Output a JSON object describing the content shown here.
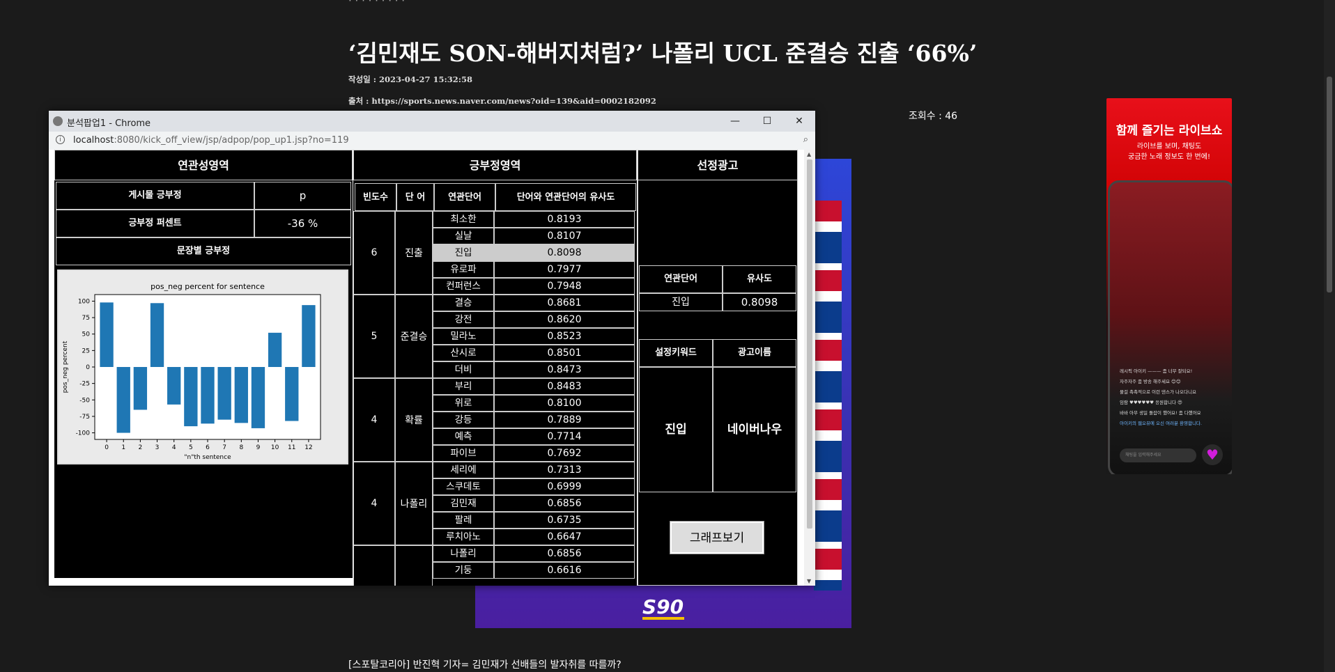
{
  "article": {
    "top_partial_text": "· · · · · · · · ·",
    "title": "‘김민재도 SON-해버지처럼?’ 나폴리 UCL 준결승 진출 ‘66%’",
    "date_line": "작성일 : 2023-04-27 15:32:58",
    "source_line": "출처 : https://sports.news.naver.com/news?oid=139&aid=0002182092",
    "views": "조회수 : 46",
    "body_first_line": "[스포탈코리아] 반진혁 기자= 김민재가 선배들의 발자취를 따를까?"
  },
  "background_ad": {
    "text": "S90"
  },
  "side_ad": {
    "headline": "함께 즐기는 라이브쇼",
    "subline1": "라이브를 보며, 채팅도",
    "subline2": "궁금한 노래 정보도 한 번에!",
    "chat_lines": [
      "레시픽 아이키 ——— 좀 너무 잘되요!",
      "자주자주 좀 방송 해주세요 😊😊",
      "물걸 촉촉적으로 이런 댄스가 나오다니요",
      "임람 ♥♥♥♥♥♥ 응원합니다 😍",
      "바바 아무 생일 돌잡이 했어요! 좀 다했어요",
      "아이키의 웹오뷰에 오신 여러분 환영합니다."
    ],
    "input_placeholder": "채팅을 입력해주세요",
    "icon": "heart-icon"
  },
  "popup": {
    "window_title": "분석팝업1 - Chrome",
    "url_host": "localhost",
    "url_path": ":8080/kick_off_view/jsp/adpop/pop_up1.jsp?no=119",
    "controls": {
      "minimize": "—",
      "maximize": "☐",
      "close": "✕"
    },
    "relevance": {
      "header": "연관성영역",
      "post_label": "게시물 긍부정",
      "post_value": "p",
      "percent_label": "긍부정 퍼센트",
      "percent_value": "-36 %",
      "sentence_label": "문장별 긍부정"
    },
    "posneg": {
      "header": "긍부정영역",
      "columns": [
        "빈도수",
        "단 어",
        "연관단어",
        "단어와 연관단어의 유사도"
      ],
      "groups": [
        {
          "freq": "6",
          "word": "진출",
          "rows": [
            {
              "word": "최소한",
              "sim": "0.8193"
            },
            {
              "word": "실날",
              "sim": "0.8107"
            },
            {
              "word": "진입",
              "sim": "0.8098",
              "highlight": true
            },
            {
              "word": "유로파",
              "sim": "0.7977"
            },
            {
              "word": "컨퍼런스",
              "sim": "0.7948"
            }
          ]
        },
        {
          "freq": "5",
          "word": "준결승",
          "rows": [
            {
              "word": "결승",
              "sim": "0.8681"
            },
            {
              "word": "강전",
              "sim": "0.8620"
            },
            {
              "word": "밀라노",
              "sim": "0.8523"
            },
            {
              "word": "산시로",
              "sim": "0.8501"
            },
            {
              "word": "더비",
              "sim": "0.8473"
            }
          ]
        },
        {
          "freq": "4",
          "word": "확률",
          "rows": [
            {
              "word": "부리",
              "sim": "0.8483"
            },
            {
              "word": "위로",
              "sim": "0.8100"
            },
            {
              "word": "강등",
              "sim": "0.7889"
            },
            {
              "word": "예측",
              "sim": "0.7714"
            },
            {
              "word": "파이브",
              "sim": "0.7692"
            }
          ]
        },
        {
          "freq": "4",
          "word": "나폴리",
          "rows": [
            {
              "word": "세리에",
              "sim": "0.7313"
            },
            {
              "word": "스쿠데토",
              "sim": "0.6999"
            },
            {
              "word": "김민재",
              "sim": "0.6856"
            },
            {
              "word": "팔레",
              "sim": "0.6735"
            },
            {
              "word": "루치아노",
              "sim": "0.6647"
            }
          ]
        },
        {
          "freq": "",
          "word": "",
          "rows": [
            {
              "word": "나폴리",
              "sim": "0.6856"
            },
            {
              "word": "기둥",
              "sim": "0.6616"
            }
          ]
        }
      ]
    },
    "ad_select": {
      "header": "선정광고",
      "assoc_word_label": "연관단어",
      "similarity_label": "유사도",
      "assoc_word": "진입",
      "similarity": "0.8098",
      "keyword_label": "설정키워드",
      "ad_name_label": "광고이름",
      "keyword": "진입",
      "ad_name": "네이버나우",
      "graph_button": "그래프보기"
    }
  },
  "chart_data": {
    "type": "bar",
    "title": "pos_neg percent for sentence",
    "xlabel": "\"n\"th sentence",
    "ylabel": "pos_neg percent",
    "categories": [
      "0",
      "1",
      "2",
      "3",
      "4",
      "5",
      "6",
      "7",
      "8",
      "9",
      "10",
      "11",
      "12"
    ],
    "values": [
      98,
      -100,
      -65,
      97,
      -57,
      -90,
      -86,
      -80,
      -85,
      -93,
      52,
      -82,
      94
    ],
    "ylim": [
      -110,
      110
    ],
    "yticks": [
      -100,
      -75,
      -50,
      -25,
      0,
      25,
      50,
      75,
      100
    ],
    "bar_color": "#1f77b4"
  }
}
